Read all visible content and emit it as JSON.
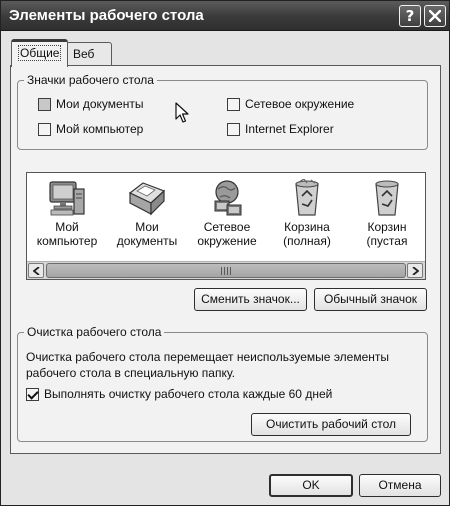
{
  "window": {
    "title": "Элементы рабочего стола"
  },
  "titlebar": {
    "help_glyph": "?"
  },
  "tabs": [
    {
      "label": "Общие",
      "active": true
    },
    {
      "label": "Веб",
      "active": false
    }
  ],
  "desktop_icons_group": {
    "legend": "Значки рабочего стола",
    "checkboxes": [
      {
        "label": "Мои документы",
        "checked": false
      },
      {
        "label": "Сетевое окружение",
        "checked": false
      },
      {
        "label": "Мой компьютер",
        "checked": false
      },
      {
        "label": "Internet Explorer",
        "checked": false
      }
    ]
  },
  "icon_list": {
    "items": [
      {
        "line1": "Мой",
        "line2": "компьютер",
        "icon": "my-computer-icon"
      },
      {
        "line1": "Мои",
        "line2": "документы",
        "icon": "my-documents-icon"
      },
      {
        "line1": "Сетевое",
        "line2": "окружение",
        "icon": "network-places-icon"
      },
      {
        "line1": "Корзина",
        "line2": "(полная)",
        "icon": "recycle-bin-full-icon"
      },
      {
        "line1": "Корзин",
        "line2": "(пустая",
        "icon": "recycle-bin-empty-icon"
      }
    ]
  },
  "icon_buttons": {
    "change": "Сменить значок...",
    "default": "Обычный значок"
  },
  "cleanup_group": {
    "legend": "Очистка рабочего стола",
    "description": "Очистка рабочего стола перемещает неиспользуемые элементы рабочего стола в специальную папку.",
    "checkbox_label": "Выполнять очистку рабочего стола каждые 60 дней",
    "checkbox_checked": true,
    "button": "Очистить рабочий стол"
  },
  "footer": {
    "ok": "OK",
    "cancel": "Отмена"
  }
}
